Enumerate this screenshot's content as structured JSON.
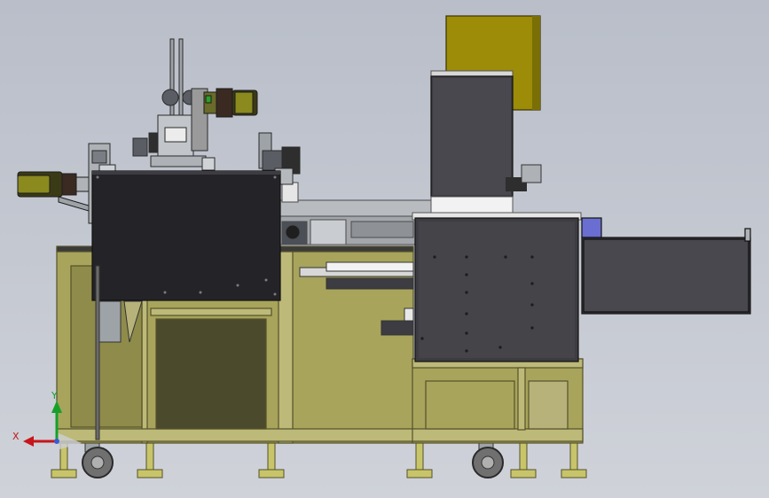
{
  "viewport": {
    "background_top": "#b9bec9",
    "background_bottom": "#cfd2d9"
  },
  "colors": {
    "frame_olive": "#a8a45c",
    "frame_edge": "#55522a",
    "panel_dark": "#242428",
    "panel_mid": "#3c3c42",
    "steel": "#9ea3a8",
    "motor_brass": "#8a8a1e",
    "motor_dark": "#3b3a16",
    "box_gold": "#9c8c08",
    "rail_grey": "#b8bcc0",
    "window_olive": "#4c4a2c"
  },
  "icons": {
    "triad": "axis-triad-icon",
    "caster": "caster-wheel-icon",
    "foot": "leveling-foot-icon",
    "motor": "servo-motor-icon"
  },
  "triad": {
    "x_label": "X",
    "y_label": "Y",
    "x_color": "#c8141a",
    "y_color": "#16a02a"
  }
}
